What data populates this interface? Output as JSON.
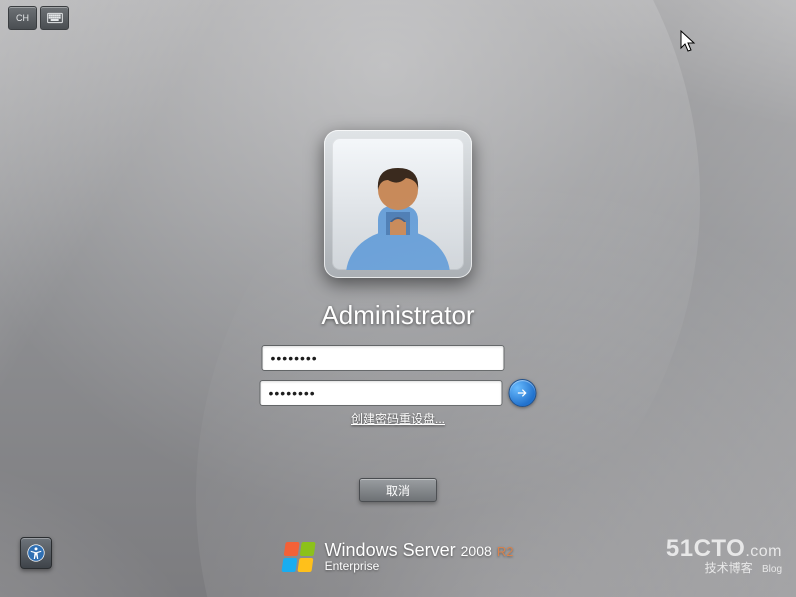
{
  "topleft": {
    "ime_label": "CH"
  },
  "login": {
    "username": "Administrator",
    "password1_placeholder": "",
    "password1_value": "••••••••",
    "password2_placeholder": "",
    "password2_value": "••••••••",
    "reset_link_label": "创建密码重设盘...",
    "cancel_label": "取消"
  },
  "branding": {
    "product_a": "Windows",
    "product_b": "Server",
    "year": "2008",
    "r2": "R2",
    "edition": "Enterprise"
  },
  "watermark": {
    "site_main": "51CTO",
    "site_suffix": ".com",
    "tagline_cn": "技术博客",
    "tagline_en": "Blog"
  }
}
